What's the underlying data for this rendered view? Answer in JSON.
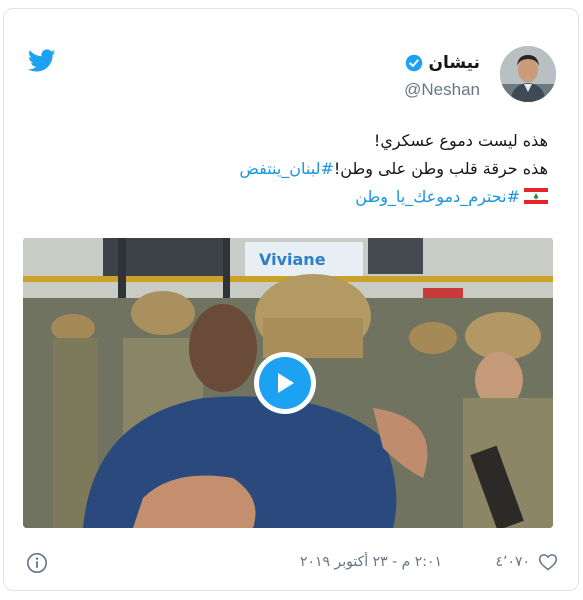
{
  "tweet": {
    "display_name": "نيشان",
    "handle": "@Neshan",
    "lines": {
      "line1": "هذه ليست دموع عسكري!",
      "line2_text": "هذه حرقة قلب وطن على وطن!",
      "line2_hashtag": "#لبنان_ينتفض",
      "line3_hashtag": "#نحترم_دموعك_يا_وطن"
    }
  },
  "media": {
    "sign_text": "Viviane"
  },
  "footer": {
    "timestamp": "٢:٠١ م - ٢٣ أكتوبر ٢٠١٩",
    "likes_count": "٤٬٠٧٠"
  },
  "icons": {
    "brand": "twitter-bird-icon",
    "verified": "verified-badge-icon",
    "flag": "lebanon-flag-icon",
    "play": "play-icon",
    "info": "info-icon",
    "like": "heart-icon"
  },
  "colors": {
    "twitter_blue": "#1da1f2",
    "link_blue": "#1b95e0",
    "text_primary": "#14171a",
    "text_secondary": "#657786",
    "border": "#dfe3e8"
  }
}
